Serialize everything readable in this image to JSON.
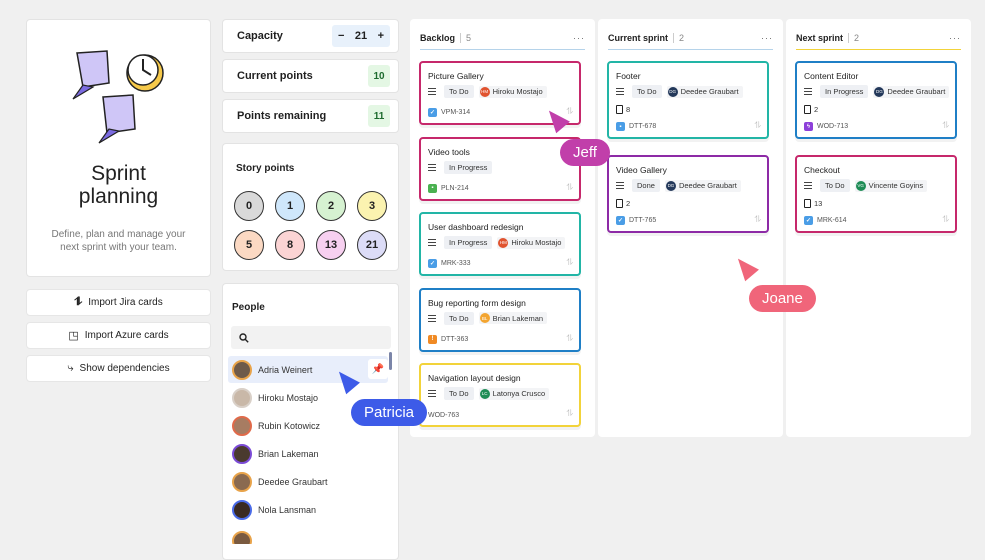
{
  "intro": {
    "title": "Sprint planning",
    "description": "Define, plan and manage your next sprint with your team."
  },
  "actions": [
    {
      "label": "Import Jira cards",
      "icon": "jira-icon"
    },
    {
      "label": "Import Azure cards",
      "icon": "azure-icon"
    },
    {
      "label": "Show dependencies",
      "icon": "dependencies-icon"
    }
  ],
  "capacity": {
    "label": "Capacity",
    "value": "21",
    "minus": "−",
    "plus": "+"
  },
  "current_points": {
    "label": "Current points",
    "value": "10"
  },
  "points_remaining": {
    "label": "Points remaining",
    "value": "11"
  },
  "story_points": {
    "label": "Story points",
    "values": [
      "0",
      "1",
      "2",
      "3",
      "5",
      "8",
      "13",
      "21"
    ],
    "colors": [
      "#d9d9d9",
      "#cfe7fb",
      "#d6f2d1",
      "#fbf3b0",
      "#fbd9c3",
      "#fbd4d4",
      "#f7d0f0",
      "#dcdcf7"
    ]
  },
  "people": {
    "label": "People",
    "list": [
      "Adria Weinert",
      "Hiroku Mostajo",
      "Rubin Kotowicz",
      "Brian Lakeman",
      "Deedee Graubart",
      "Nola Lansman"
    ]
  },
  "columns": [
    {
      "title": "Backlog",
      "count": "5",
      "more": "···",
      "rule_color": "#b5d3ea",
      "cards": [
        {
          "title": "Picture Gallery",
          "status": "To Do",
          "assignee": "Hiroku Mostajo",
          "initials": "HM",
          "avatar_color": "#e0532f",
          "points": "",
          "key": "VPM-314",
          "type_color": "#4a9de6",
          "type_glyph": "✓",
          "border": "#c6286b"
        },
        {
          "title": "Video tools",
          "status": "In Progress",
          "assignee": "",
          "initials": "",
          "avatar_color": "",
          "points": "",
          "key": "PLN-214",
          "type_color": "#4ab150",
          "type_glyph": "▪",
          "border": "#c6286b"
        },
        {
          "title": "User dashboard redesign",
          "status": "In Progress",
          "assignee": "Hiroku Mostajo",
          "initials": "HM",
          "avatar_color": "#e0532f",
          "points": "",
          "key": "MRK-333",
          "type_color": "#4a9de6",
          "type_glyph": "✓",
          "border": "#22b5a6"
        },
        {
          "title": "Bug reporting form design",
          "status": "To Do",
          "assignee": "Brian Lakeman",
          "initials": "BL",
          "avatar_color": "#f3a531",
          "points": "",
          "key": "DTT-363",
          "type_color": "#f08a24",
          "type_glyph": "!",
          "border": "#1f7fc6"
        },
        {
          "title": "Navigation layout design",
          "status": "To Do",
          "assignee": "Latonya Crusco",
          "initials": "LC",
          "avatar_color": "#1e8c56",
          "points": "",
          "key": "WOD-763",
          "type_color": "",
          "type_glyph": "",
          "border": "#f2d33a"
        }
      ]
    },
    {
      "title": "Current sprint",
      "count": "2",
      "more": "···",
      "rule_color": "#b5d3ea",
      "cards": [
        {
          "title": "Footer",
          "status": "To Do",
          "assignee": "Deedee Graubart",
          "initials": "DG",
          "avatar_color": "#23385a",
          "points": "8",
          "key": "DTT-678",
          "type_color": "#4a9de6",
          "type_glyph": "▪",
          "border": "#22b5a6"
        },
        {
          "title": "Video Gallery",
          "status": "Done",
          "assignee": "Deedee Graubart",
          "initials": "DG",
          "avatar_color": "#23385a",
          "points": "2",
          "key": "DTT-765",
          "type_color": "#4a9de6",
          "type_glyph": "✓",
          "border": "#8d2aa6"
        }
      ]
    },
    {
      "title": "Next sprint",
      "count": "2",
      "more": "···",
      "rule_color": "#f2d33a",
      "cards": [
        {
          "title": "Content Editor",
          "status": "In Progress",
          "assignee": "Deedee Graubart",
          "initials": "DG",
          "avatar_color": "#23385a",
          "points": "2",
          "key": "WOD-713",
          "type_color": "#8d3fd9",
          "type_glyph": "ϟ",
          "border": "#1f7fc6"
        },
        {
          "title": "Checkout",
          "status": "To Do",
          "assignee": "Vincente Goyins",
          "initials": "VG",
          "avatar_color": "#1e8c56",
          "points": "13",
          "key": "MRK-614",
          "type_color": "#4a9de6",
          "type_glyph": "✓",
          "border": "#c6286b"
        }
      ]
    }
  ],
  "cursors": [
    {
      "name": "Jeff",
      "color": "#c13faa"
    },
    {
      "name": "Joane",
      "color": "#f0657a"
    },
    {
      "name": "Patricia",
      "color": "#3d5be8"
    }
  ]
}
